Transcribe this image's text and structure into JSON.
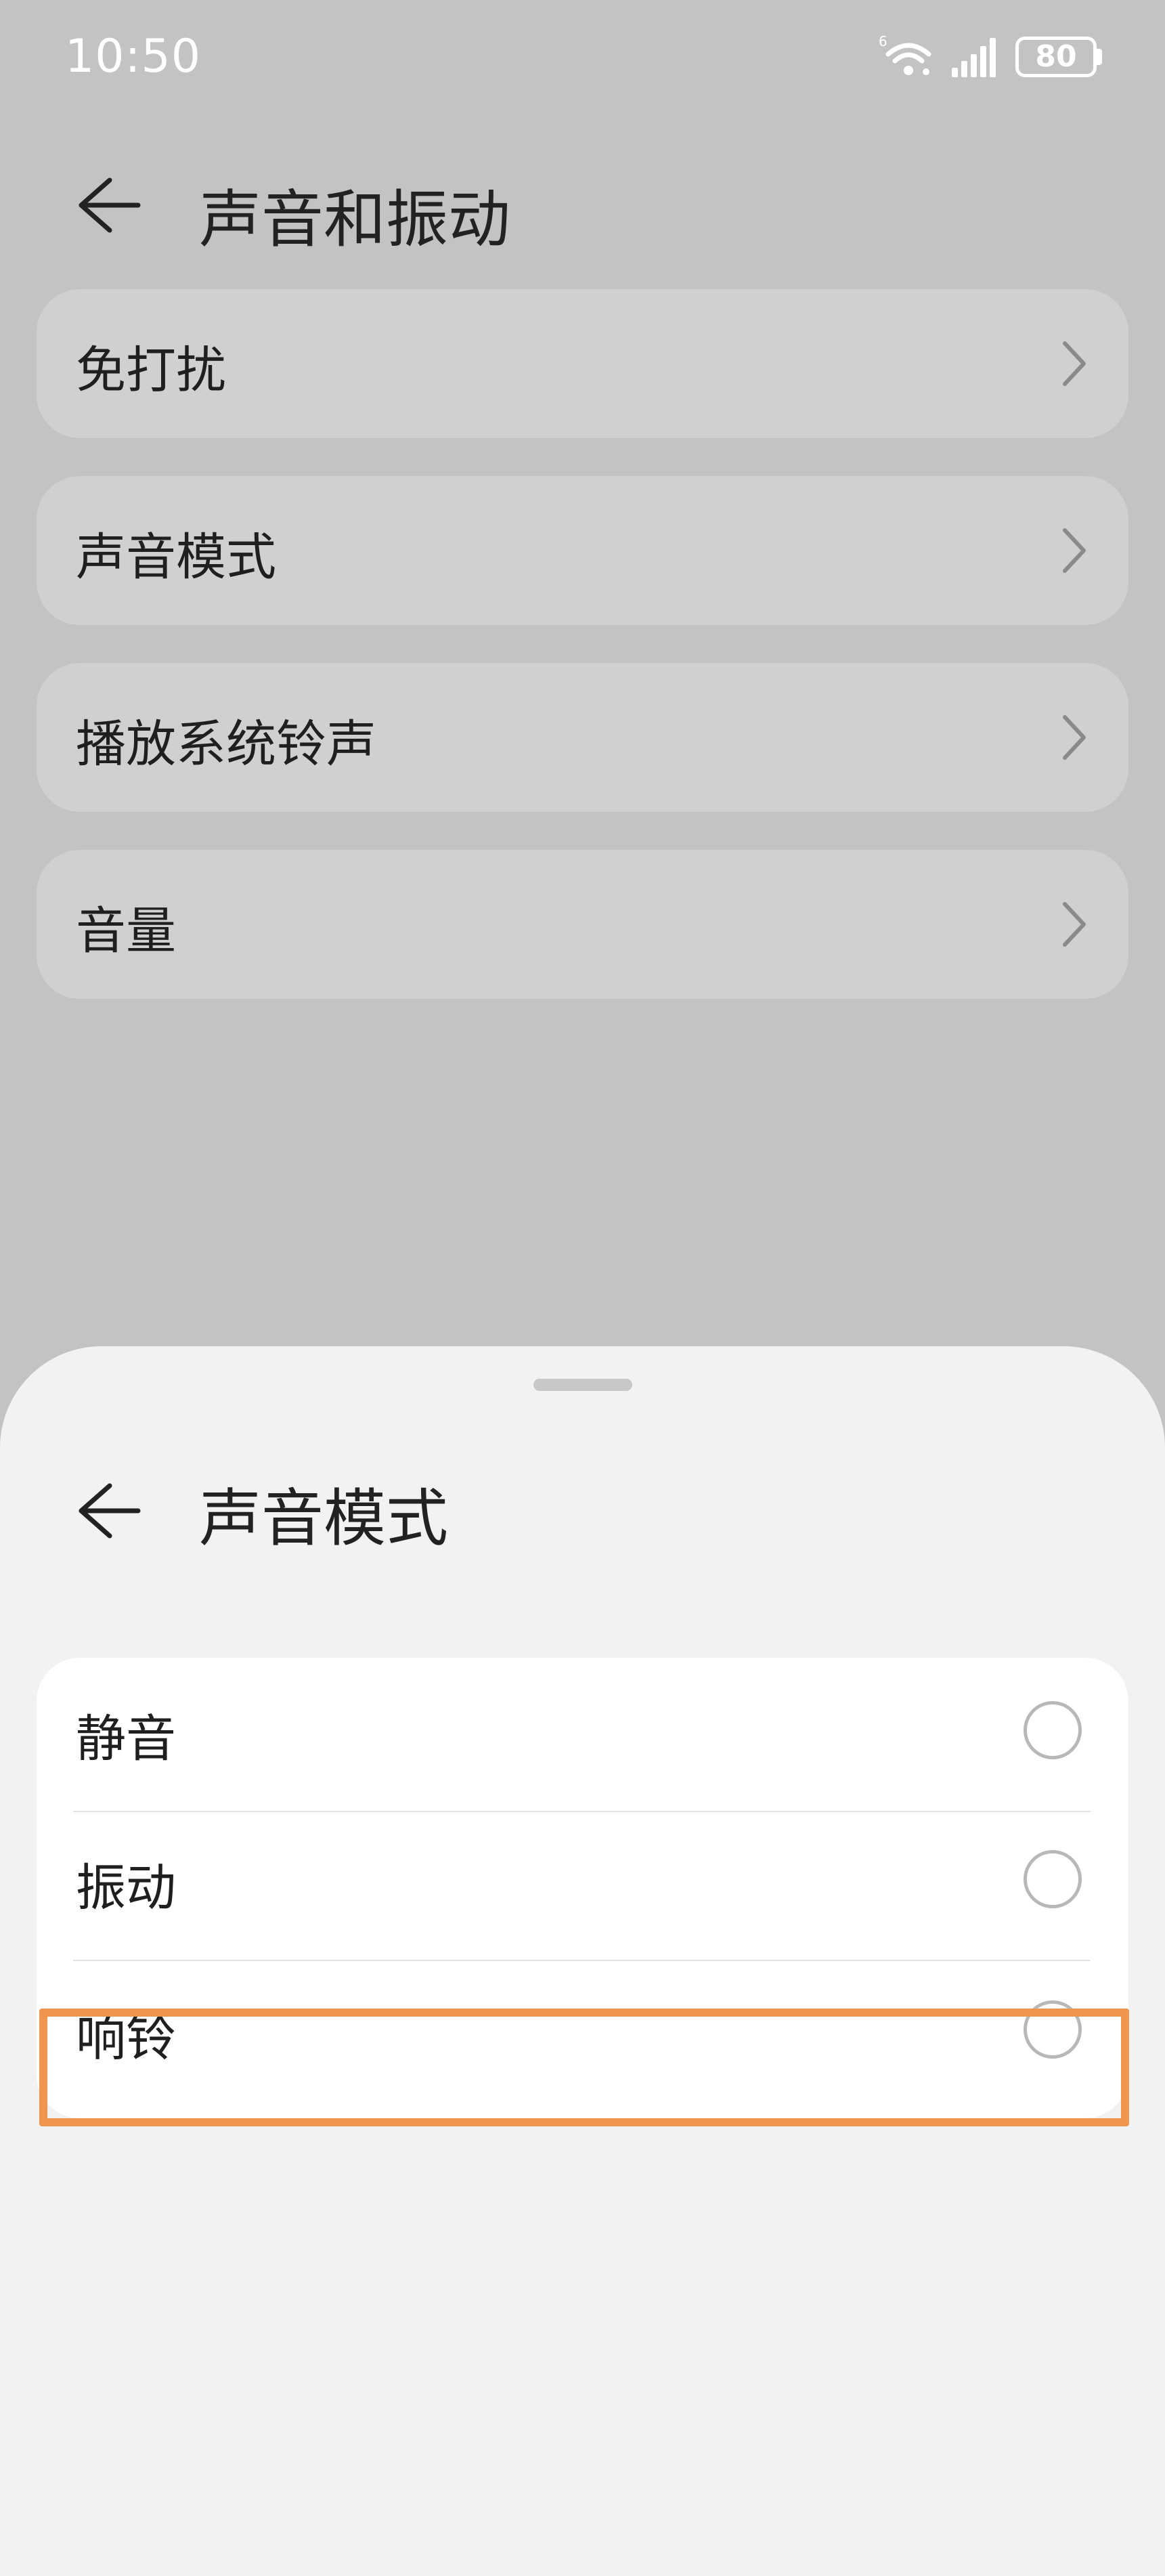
{
  "status_bar": {
    "time": "10:50",
    "wifi_badge": "6",
    "battery": "80",
    "icons": [
      "wifi-icon",
      "signal-icon",
      "battery-icon"
    ]
  },
  "header": {
    "back_icon": "arrow-left-icon",
    "title": "声音和振动"
  },
  "settings": {
    "items": [
      {
        "label": "免打扰",
        "icon": "chevron-right-icon"
      },
      {
        "label": "声音模式",
        "icon": "chevron-right-icon"
      },
      {
        "label": "播放系统铃声",
        "icon": "chevron-right-icon"
      },
      {
        "label": "音量",
        "icon": "chevron-right-icon"
      }
    ]
  },
  "sheet": {
    "back_icon": "arrow-left-icon",
    "title": "声音模式",
    "options": [
      {
        "label": "静音",
        "selected": false
      },
      {
        "label": "振动",
        "selected": false
      },
      {
        "label": "响铃",
        "selected": false
      }
    ]
  },
  "colors": {
    "overlay_bg": "#c2c3c5",
    "sheet_bg": "#f1f2f4",
    "highlight": "#f0954e"
  }
}
